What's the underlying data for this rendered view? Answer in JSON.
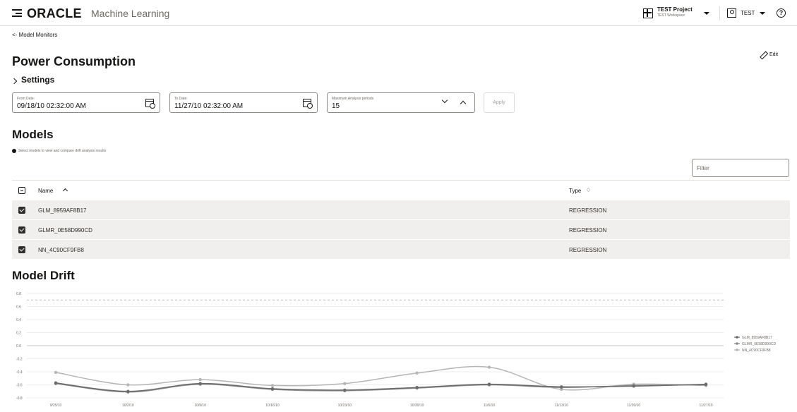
{
  "header": {
    "brand": "ORACLE",
    "app_name": "Machine Learning",
    "project_name": "TEST Project",
    "workspace_name": "TEST Workspace",
    "user_name": "TEST",
    "help_glyph": "?"
  },
  "breadcrumb": "<- Model Monitors",
  "page_title": "Power Consumption",
  "edit_label": "Edit",
  "settings_label": "Settings",
  "form": {
    "from_label": "From Date:",
    "from_value": "09/18/10 02:32:00 AM",
    "to_label": "To Date:",
    "to_value": "11/27/10 02:32:00 AM",
    "max_label": "Maximum Analysis periods",
    "max_value": "15",
    "apply_label": "Apply"
  },
  "models": {
    "title": "Models",
    "info": "Select models to view and compare drift analysis results",
    "filter_placeholder": "Filter",
    "columns": [
      "Name",
      "Type"
    ],
    "sort_glyph": "♢",
    "rows": [
      {
        "name": "GLM_8959AF8B17",
        "type": "REGRESSION",
        "checked": true
      },
      {
        "name": "GLMR_0E58D990CD",
        "type": "REGRESSION",
        "checked": true
      },
      {
        "name": "NN_4C90CF9FB8",
        "type": "REGRESSION",
        "checked": true
      }
    ]
  },
  "drift": {
    "title": "Model Drift"
  },
  "chart_data": {
    "type": "line",
    "title": "",
    "xlabel": "",
    "ylabel": "",
    "x": [
      "9/25/10",
      "10/2/10",
      "10/9/10",
      "10/16/10",
      "10/23/10",
      "10/30/10",
      "11/6/10",
      "11/13/10",
      "11/20/10",
      "11/27/10"
    ],
    "ylim": [
      -0.8,
      0.8
    ],
    "yticks": [
      0.8,
      0.6,
      0.4,
      0.2,
      0.0,
      -0.2,
      -0.4,
      -0.6,
      -0.8
    ],
    "reference_line": 0.7,
    "grid": true,
    "legend_position": "right",
    "series": [
      {
        "name": "GLM_8959AF8B17",
        "color": "#6a6a6a",
        "values": [
          -0.57,
          -0.7,
          -0.58,
          -0.66,
          -0.68,
          -0.64,
          -0.59,
          -0.63,
          -0.62,
          -0.59
        ]
      },
      {
        "name": "GLMR_0E58D990CD",
        "color": "#8a8a8a",
        "values": [
          -0.58,
          -0.71,
          -0.59,
          -0.67,
          -0.69,
          -0.65,
          -0.6,
          -0.64,
          -0.61,
          -0.6
        ]
      },
      {
        "name": "NN_4C90CF9FB8",
        "color": "#b5b5b5",
        "values": [
          -0.41,
          -0.6,
          -0.52,
          -0.61,
          -0.58,
          -0.42,
          -0.33,
          -0.67,
          -0.59,
          -0.61
        ]
      }
    ]
  }
}
